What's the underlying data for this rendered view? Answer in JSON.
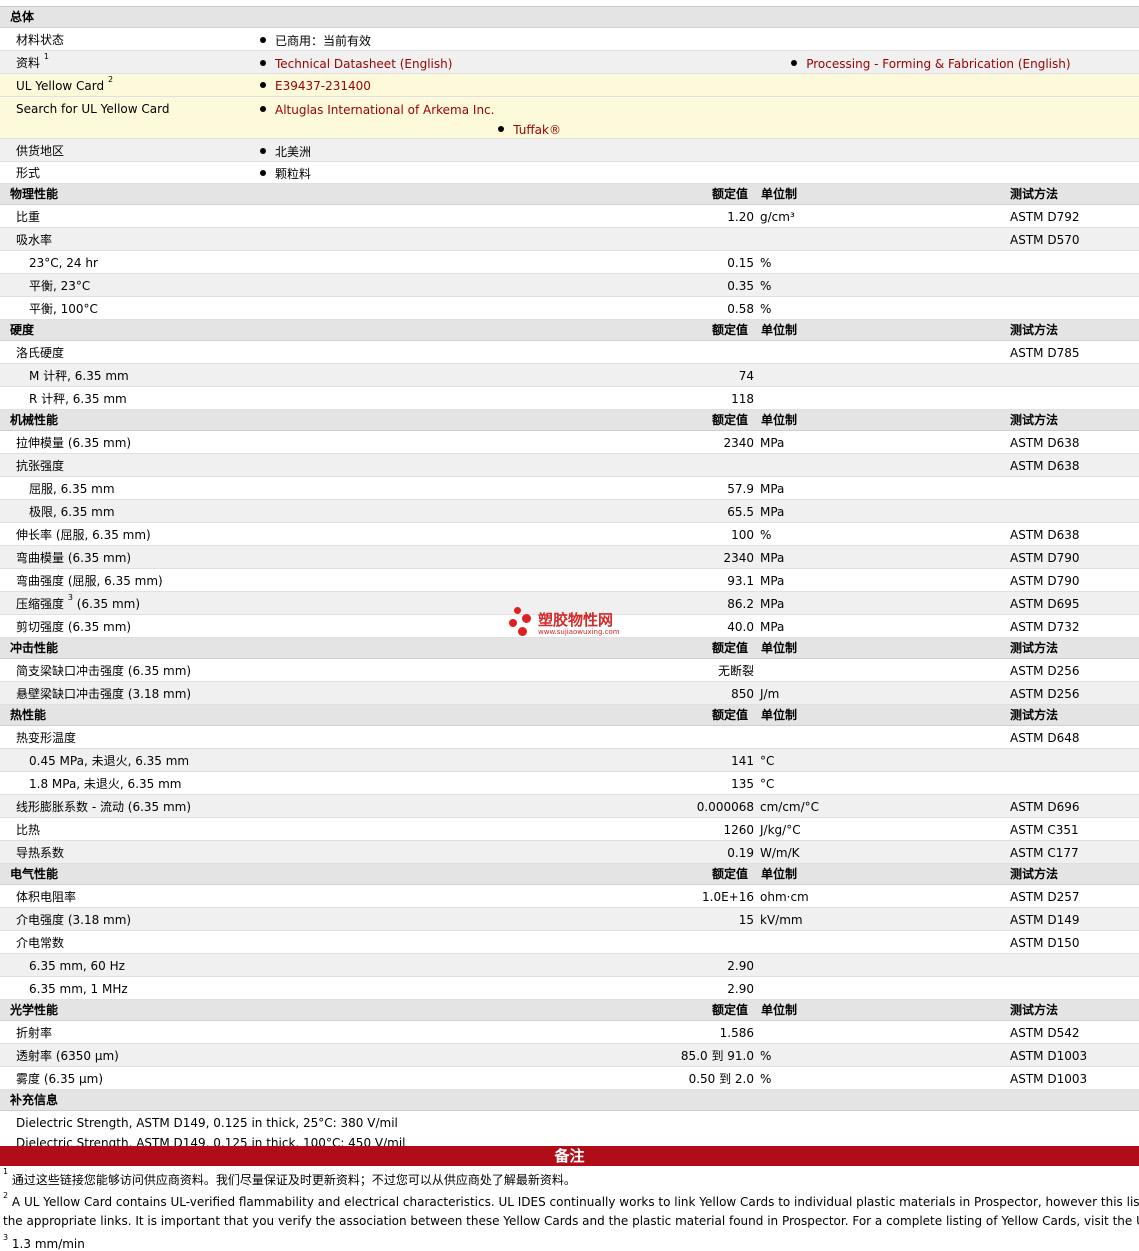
{
  "general": {
    "title": "总体",
    "material_status": {
      "label": "材料状态",
      "value": "已商用：当前有效"
    },
    "docs": {
      "label": "资料",
      "sup": "1",
      "links": [
        "Technical Datasheet (English)",
        "Processing - Forming & Fabrication (English)"
      ]
    },
    "ul_card": {
      "label": "UL Yellow Card",
      "sup": "2",
      "link": "E39437-231400"
    },
    "ul_search": {
      "label": "Search for UL Yellow Card",
      "links": [
        "Altuglas International of Arkema Inc.",
        "Tuffak®"
      ]
    },
    "region": {
      "label": "供货地区",
      "value": "北美洲"
    },
    "form": {
      "label": "形式",
      "value": "颗粒料"
    }
  },
  "col_headers": {
    "value": "额定值",
    "unit": "单位制",
    "method": "测试方法"
  },
  "sections": [
    {
      "title": "物理性能",
      "rows": [
        {
          "label": "比重",
          "value": "1.20",
          "unit": "g/cm³",
          "method": "ASTM D792"
        },
        {
          "label": "吸水率",
          "value": "",
          "unit": "",
          "method": "ASTM D570"
        },
        {
          "label": "23°C, 24 hr",
          "indent": true,
          "value": "0.15",
          "unit": "%",
          "method": ""
        },
        {
          "label": "平衡, 23°C",
          "indent": true,
          "value": "0.35",
          "unit": "%",
          "method": ""
        },
        {
          "label": "平衡, 100°C",
          "indent": true,
          "value": "0.58",
          "unit": "%",
          "method": ""
        }
      ]
    },
    {
      "title": "硬度",
      "rows": [
        {
          "label": "洛氏硬度",
          "value": "",
          "unit": "",
          "method": "ASTM D785"
        },
        {
          "label": "M 计秤, 6.35 mm",
          "indent": true,
          "value": "74",
          "unit": "",
          "method": ""
        },
        {
          "label": "R 计秤, 6.35 mm",
          "indent": true,
          "value": "118",
          "unit": "",
          "method": ""
        }
      ]
    },
    {
      "title": "机械性能",
      "rows": [
        {
          "label": "拉伸模量 (6.35 mm)",
          "value": "2340",
          "unit": "MPa",
          "method": "ASTM D638"
        },
        {
          "label": "抗张强度",
          "value": "",
          "unit": "",
          "method": "ASTM D638"
        },
        {
          "label": "屈服, 6.35 mm",
          "indent": true,
          "value": "57.9",
          "unit": "MPa",
          "method": ""
        },
        {
          "label": "极限, 6.35 mm",
          "indent": true,
          "value": "65.5",
          "unit": "MPa",
          "method": ""
        },
        {
          "label": "伸长率 (屈服, 6.35 mm)",
          "value": "100",
          "unit": "%",
          "method": "ASTM D638"
        },
        {
          "label": "弯曲模量 (6.35 mm)",
          "value": "2340",
          "unit": "MPa",
          "method": "ASTM D790"
        },
        {
          "label": "弯曲强度 (屈服, 6.35 mm)",
          "value": "93.1",
          "unit": "MPa",
          "method": "ASTM D790"
        },
        {
          "label": "压缩强度",
          "sup": "3",
          "label_after": "(6.35 mm)",
          "value": "86.2",
          "unit": "MPa",
          "method": "ASTM D695"
        },
        {
          "label": "剪切强度 (6.35 mm)",
          "value": "40.0",
          "unit": "MPa",
          "method": "ASTM D732"
        }
      ]
    },
    {
      "title": "冲击性能",
      "rows": [
        {
          "label": "简支梁缺口冲击强度 (6.35 mm)",
          "value": "无断裂",
          "unit": "",
          "method": "ASTM D256"
        },
        {
          "label": "悬壁梁缺口冲击强度 (3.18 mm)",
          "value": "850",
          "unit": "J/m",
          "method": "ASTM D256"
        }
      ]
    },
    {
      "title": "热性能",
      "rows": [
        {
          "label": "热变形温度",
          "value": "",
          "unit": "",
          "method": "ASTM D648"
        },
        {
          "label": "0.45 MPa, 未退火, 6.35 mm",
          "indent": true,
          "value": "141",
          "unit": "°C",
          "method": ""
        },
        {
          "label": "1.8 MPa, 未退火, 6.35 mm",
          "indent": true,
          "value": "135",
          "unit": "°C",
          "method": ""
        },
        {
          "label": "线形膨胀系数 - 流动 (6.35 mm)",
          "value": "0.000068",
          "unit": "cm/cm/°C",
          "method": "ASTM D696"
        },
        {
          "label": "比热",
          "value": "1260",
          "unit": "J/kg/°C",
          "method": "ASTM C351"
        },
        {
          "label": "导热系数",
          "value": "0.19",
          "unit": "W/m/K",
          "method": "ASTM C177"
        }
      ]
    },
    {
      "title": "电气性能",
      "rows": [
        {
          "label": "体积电阻率",
          "value": "1.0E+16",
          "unit": "ohm·cm",
          "method": "ASTM D257"
        },
        {
          "label": "介电强度 (3.18 mm)",
          "value": "15",
          "unit": "kV/mm",
          "method": "ASTM D149"
        },
        {
          "label": "介电常数",
          "value": "",
          "unit": "",
          "method": "ASTM D150"
        },
        {
          "label": "6.35 mm, 60 Hz",
          "indent": true,
          "value": "2.90",
          "unit": "",
          "method": ""
        },
        {
          "label": "6.35 mm, 1 MHz",
          "indent": true,
          "value": "2.90",
          "unit": "",
          "method": ""
        }
      ]
    },
    {
      "title": "光学性能",
      "rows": [
        {
          "label": "折射率",
          "value": "1.586",
          "unit": "",
          "method": "ASTM D542"
        },
        {
          "label": "透射率 (6350 µm)",
          "value": "85.0 到  91.0",
          "unit": "%",
          "method": "ASTM D1003"
        },
        {
          "label": "雾度 (6.35 µm)",
          "value": "0.50 到  2.0",
          "unit": "%",
          "method": "ASTM D1003"
        }
      ]
    }
  ],
  "supplement": {
    "title": "补充信息",
    "lines": [
      "Dielectric Strength, ASTM D149, 0.125 in thick, 25°C: 380 V/mil",
      "Dielectric Strength, ASTM D149, 0.125 in thick, 100°C: 450 V/mil"
    ]
  },
  "notes": {
    "title": "备注",
    "items": [
      {
        "num": "1",
        "text": "通过这些链接您能够访问供应商资料。我们尽量保证及时更新资料；不过您可以从供应商处了解最新资料。"
      },
      {
        "num": "2",
        "text": "A UL Yellow Card contains UL-verified flammability and electrical characteristics. UL IDES continually works to link Yellow Cards to individual plastic materials in Prospector, however this list ma",
        "text2": "the appropriate links. It is important that you verify the association between these Yellow Cards and the plastic material found in Prospector. For a complete listing of Yellow Cards, visit the UL Yello"
      },
      {
        "num": "3",
        "text": "1.3 mm/min"
      }
    ]
  },
  "watermark": {
    "main": "塑胶物性网",
    "url": "www.sujiaowuxing.com"
  }
}
